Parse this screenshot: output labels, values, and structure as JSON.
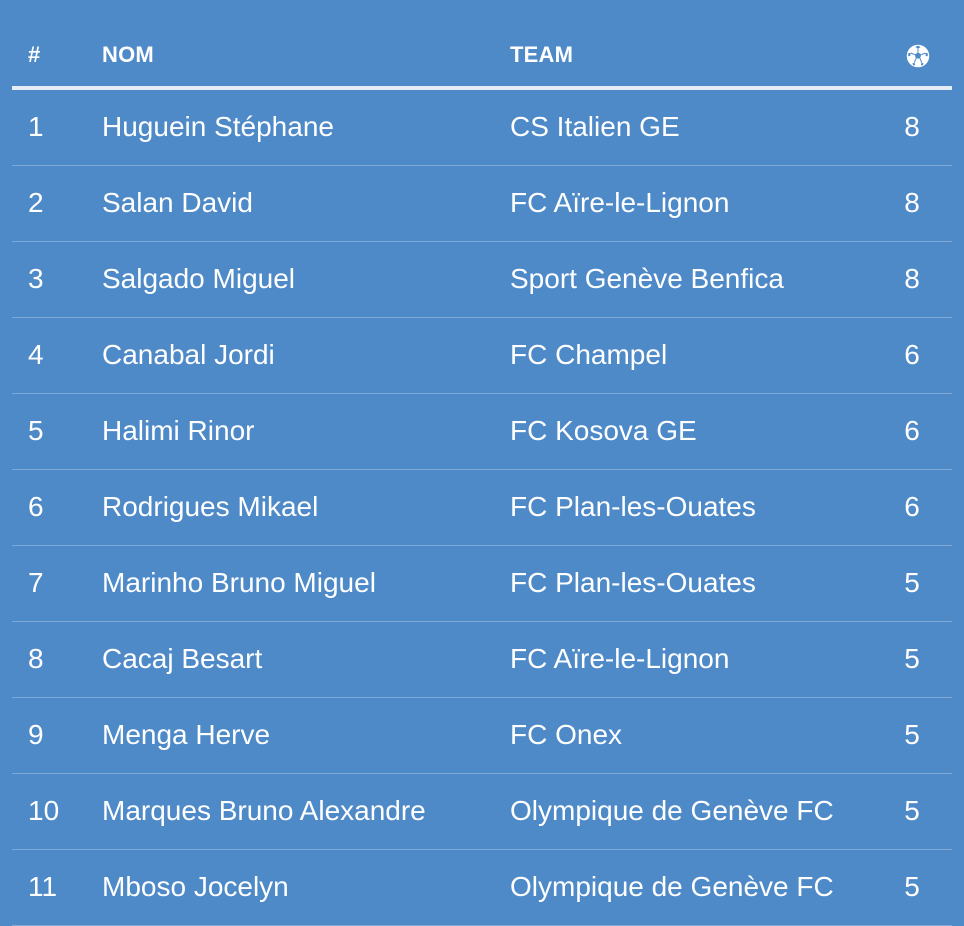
{
  "table": {
    "headers": {
      "rank": "#",
      "name": "NOM",
      "team": "TEAM",
      "goals_icon": "soccer-ball-icon"
    },
    "rows": [
      {
        "rank": "1",
        "name": "Huguein Stéphane",
        "team": "CS Italien GE",
        "goals": "8"
      },
      {
        "rank": "2",
        "name": "Salan David",
        "team": "FC Aïre-le-Lignon",
        "goals": "8"
      },
      {
        "rank": "3",
        "name": "Salgado Miguel",
        "team": "Sport Genève Benfica",
        "goals": "8"
      },
      {
        "rank": "4",
        "name": "Canabal Jordi",
        "team": "FC Champel",
        "goals": "6"
      },
      {
        "rank": "5",
        "name": "Halimi Rinor",
        "team": "FC Kosova GE",
        "goals": "6"
      },
      {
        "rank": "6",
        "name": "Rodrigues Mikael",
        "team": "FC Plan-les-Ouates",
        "goals": "6"
      },
      {
        "rank": "7",
        "name": "Marinho Bruno Miguel",
        "team": "FC Plan-les-Ouates",
        "goals": "5"
      },
      {
        "rank": "8",
        "name": "Cacaj Besart",
        "team": "FC Aïre-le-Lignon",
        "goals": "5"
      },
      {
        "rank": "9",
        "name": "Menga Herve",
        "team": "FC Onex",
        "goals": "5"
      },
      {
        "rank": "10",
        "name": "Marques Bruno Alexandre",
        "team": "Olympique de Genève FC",
        "goals": "5"
      },
      {
        "rank": "11",
        "name": "Mboso Jocelyn",
        "team": "Olympique de Genève FC",
        "goals": "5"
      }
    ]
  },
  "colors": {
    "background": "#4e89c8",
    "text": "#ffffff",
    "header_rule": "#e6ecf3"
  }
}
